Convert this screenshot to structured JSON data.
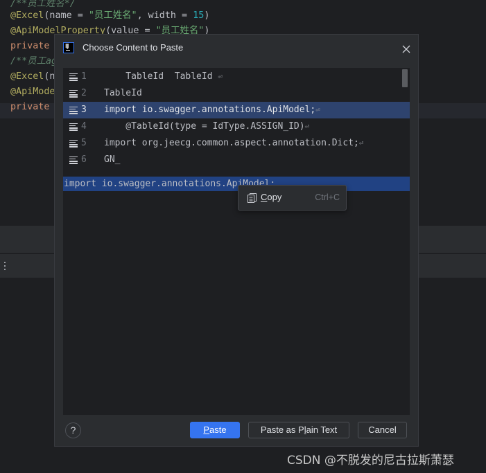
{
  "editor": {
    "lines": [
      {
        "parts": [
          {
            "cls": "c-comment",
            "text": "/**员工姓名*/"
          }
        ]
      },
      {
        "parts": [
          {
            "cls": "c-anno",
            "text": "@Excel"
          },
          {
            "cls": "c-plain",
            "text": "(name = "
          },
          {
            "cls": "c-str",
            "text": "\"员工姓名\""
          },
          {
            "cls": "c-plain",
            "text": ", width = "
          },
          {
            "cls": "c-num",
            "text": "15"
          },
          {
            "cls": "c-plain",
            "text": ")"
          }
        ]
      },
      {
        "parts": [
          {
            "cls": "c-anno",
            "text": "@ApiModelProperty"
          },
          {
            "cls": "c-plain",
            "text": "(value = "
          },
          {
            "cls": "c-str",
            "text": "\"员工姓名\""
          },
          {
            "cls": "c-plain",
            "text": ")"
          }
        ]
      },
      {
        "parts": [
          {
            "cls": "c-kw",
            "text": "private"
          }
        ]
      },
      {
        "parts": [
          {
            "cls": "c-comment",
            "text": "/**员工age"
          }
        ]
      },
      {
        "parts": [
          {
            "cls": "c-anno",
            "text": "@Excel"
          },
          {
            "cls": "c-plain",
            "text": "(n"
          }
        ]
      },
      {
        "parts": [
          {
            "cls": "c-anno",
            "text": "@ApiMode"
          }
        ]
      },
      {
        "parts": [
          {
            "cls": "c-kw",
            "text": "private"
          }
        ]
      }
    ]
  },
  "dialog": {
    "title": "Choose Content to Paste",
    "app_icon_text": "IJ",
    "list_items": [
      {
        "num": "1",
        "text": "    TableId  TableId ",
        "ret": "⏎",
        "selected": false
      },
      {
        "num": "2",
        "text": "TableId",
        "ret": "",
        "selected": false
      },
      {
        "num": "3",
        "text": "import io.swagger.annotations.ApiModel;",
        "ret": "⏎",
        "selected": true
      },
      {
        "num": "4",
        "text": "    @TableId(type = IdType.ASSIGN_ID)",
        "ret": "⏎",
        "selected": false
      },
      {
        "num": "5",
        "text": "import org.jeecg.common.aspect.annotation.Dict;",
        "ret": "⏎",
        "selected": false
      },
      {
        "num": "6",
        "text": "GN_",
        "ret": "",
        "selected": false
      }
    ],
    "preview_text": "import io.swagger.annotations.ApiModel;",
    "context_menu": {
      "copy_label_mnemonic": "C",
      "copy_label_rest": "opy",
      "copy_shortcut": "Ctrl+C"
    },
    "buttons": {
      "help": "?",
      "paste_mnemonic": "P",
      "paste_rest": "aste",
      "plain_before": "Paste as P",
      "plain_mnemonic": "l",
      "plain_after": "ain Text",
      "cancel": "Cancel"
    }
  },
  "watermark": "CSDN @不脱发的尼古拉斯萧瑟"
}
